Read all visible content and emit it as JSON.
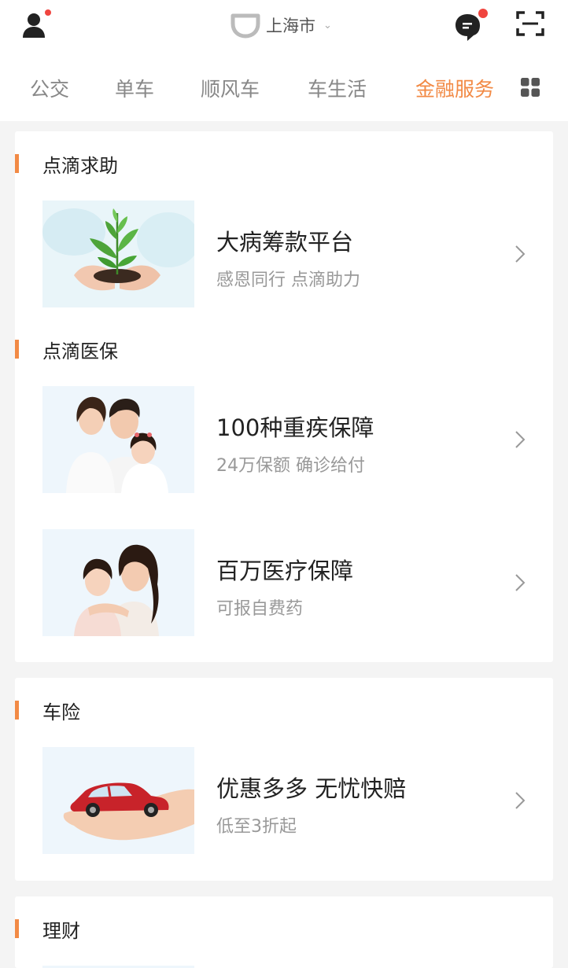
{
  "header": {
    "city": "上海市"
  },
  "tabs": [
    "公交",
    "单车",
    "顺风车",
    "车生活",
    "金融服务"
  ],
  "active_tab": "金融服务",
  "colors": {
    "accent": "#f28a45",
    "badge": "#f0453f"
  },
  "sections": [
    {
      "title": "点滴求助",
      "items": [
        {
          "name": "大病筹款平台",
          "desc": "感恩同行 点滴助力",
          "image": "hands-with-sprout"
        }
      ]
    },
    {
      "title": "点滴医保",
      "items": [
        {
          "name": "100种重疾保障",
          "desc": "24万保额 确诊给付",
          "image": "family-photo"
        },
        {
          "name": "百万医疗保障",
          "desc": "可报自费药",
          "image": "mother-daughter-photo"
        }
      ]
    },
    {
      "title": "车险",
      "items": [
        {
          "name": "优惠多多 无忧快赔",
          "desc": "低至3折起",
          "image": "hand-holding-car"
        }
      ]
    },
    {
      "title": "理财",
      "items": []
    }
  ],
  "icons": {
    "user": "user-icon",
    "message": "message-icon",
    "scan": "scan-icon",
    "grid": "grid-icon",
    "chevron": "chevron-right-icon"
  }
}
